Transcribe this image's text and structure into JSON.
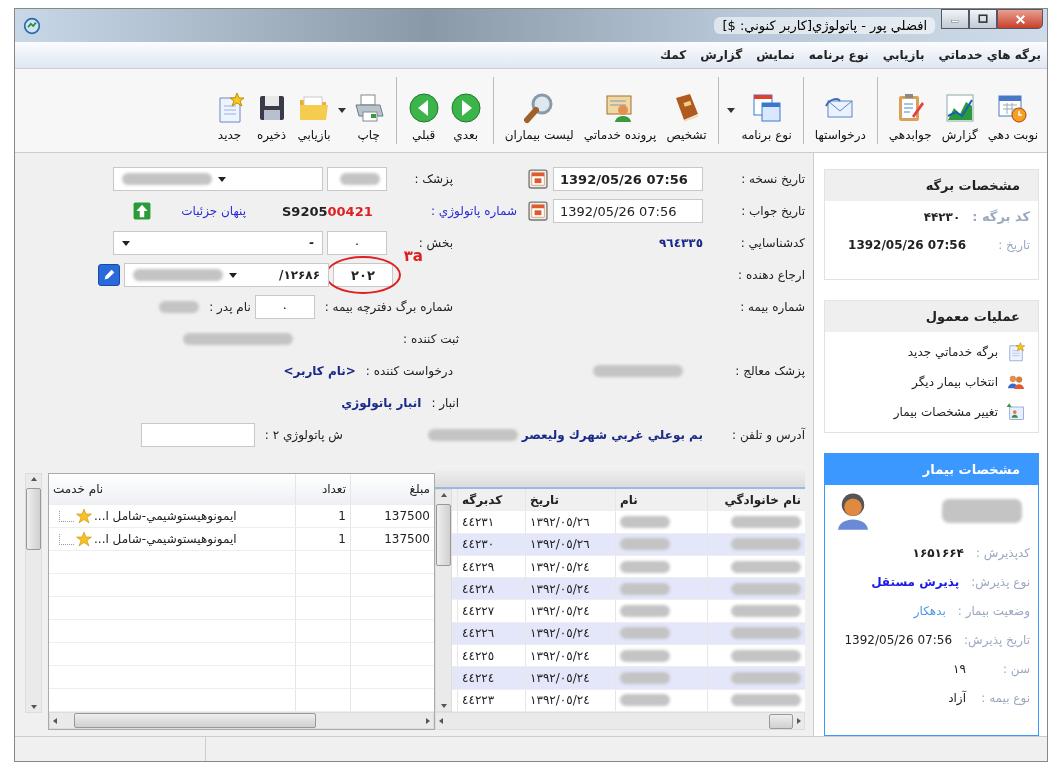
{
  "window": {
    "title": "افضلي پور - پاتولوژي[كاربر كنوني: $]"
  },
  "menu": [
    "برگه هاي خدماتي",
    "بازيابي",
    "نوع برنامه",
    "نمايش",
    "گزارش",
    "كمك"
  ],
  "toolbar": [
    [
      {
        "label": "نوبت دهي",
        "kind": "calendar"
      },
      {
        "label": "گزارش",
        "kind": "chart"
      },
      {
        "label": "جوابدهي",
        "kind": "clipboard"
      }
    ],
    [
      {
        "label": "درخواستها",
        "kind": "mail"
      }
    ],
    [
      {
        "label": "نوع برنامه",
        "kind": "windows",
        "dropdown": true
      }
    ],
    [
      {
        "label": "تشخيص",
        "kind": "book"
      },
      {
        "label": "پرونده خدماتي",
        "kind": "file"
      },
      {
        "label": "ليست بيماران",
        "kind": "search"
      }
    ],
    [
      {
        "label": "بعدي",
        "kind": "next"
      },
      {
        "label": "قبلي",
        "kind": "prev"
      }
    ],
    [
      {
        "label": "چاپ",
        "kind": "printer",
        "dropdown": true
      },
      {
        "label": "بازيابي",
        "kind": "folder"
      },
      {
        "label": "ذخيره",
        "kind": "save"
      },
      {
        "label": "جديد",
        "kind": "new"
      }
    ]
  ],
  "form": {
    "prescription_date": {
      "label": "تاريخ نسخه :",
      "value": "1392/05/26 07:56"
    },
    "physician": {
      "label": "پزشک :"
    },
    "answer_date": {
      "label": "تاريخ جواب :",
      "value": "1392/05/26 07:56"
    },
    "pathology_no": {
      "label": "شماره پاتولوژي :",
      "prefix": "S9205",
      "number": "00421"
    },
    "hide_details": {
      "label": "پنهان جزئيات"
    },
    "id_code": {
      "label": "كدشناسايي :",
      "value": "٩٦٤٣٣٥"
    },
    "ward": {
      "label": "بخش :",
      "code": "۰",
      "name": "-"
    },
    "referrer": {
      "label": "ارجاع دهنده :",
      "code": "۲۰۲",
      "name": "۱۲۶۸۶/"
    },
    "annotation": {
      "label": "۳a"
    },
    "insurance_no": {
      "label": "شماره بيمه :"
    },
    "booklet_page": {
      "label": "شماره برگ دفترچه بيمه :",
      "value": "۰"
    },
    "father_name": {
      "label": "نام پدر :"
    },
    "registrar": {
      "label": "ثبت كننده :"
    },
    "treating_physician": {
      "label": "پزشک معالج :"
    },
    "requester": {
      "label": "درخواست كننده :",
      "value": "<نام كاربر>"
    },
    "store": {
      "label": "انبار :",
      "value": "انبار پاتولوژي"
    },
    "address": {
      "label": "آدرس و تلفن :",
      "value": "بم بوعلي غربي شهرك وليعصر"
    },
    "pathology_no_2": {
      "label": "ش پاتولوژي ۲ :"
    }
  },
  "services": {
    "columns": [
      "مبلغ",
      "تعداد",
      "نام خدمت"
    ],
    "rows": [
      {
        "amount": "137500",
        "count": "1",
        "name": "ايمونوهيستوشيمي-شامل ا..."
      },
      {
        "amount": "137500",
        "count": "1",
        "name": "ايمونوهيستوشيمي-شامل ا..."
      }
    ]
  },
  "sheets": {
    "columns": [
      "نام خانوادگي",
      "نام",
      "تاريخ",
      "كدبرگه"
    ],
    "rows": [
      {
        "date": "١٣٩٢/٠٥/٢٦",
        "code": "٤٤٢٣١"
      },
      {
        "date": "١٣٩٢/٠٥/٢٦",
        "code": "٤٤٢٣٠"
      },
      {
        "date": "١٣٩٢/٠٥/٢٤",
        "code": "٤٤٢٢٩"
      },
      {
        "date": "١٣٩٢/٠٥/٢٤",
        "code": "٤٤٢٢٨"
      },
      {
        "date": "١٣٩٢/٠٥/٢٤",
        "code": "٤٤٢٢٧"
      },
      {
        "date": "١٣٩٢/٠٥/٢٤",
        "code": "٤٤٢٢٦"
      },
      {
        "date": "١٣٩٢/٠٥/٢٤",
        "code": "٤٤٢٢٥"
      },
      {
        "date": "١٣٩٢/٠٥/٢٤",
        "code": "٤٤٢٢٤"
      },
      {
        "date": "١٣٩٢/٠٥/٢٤",
        "code": "٤٤٢٢٣"
      }
    ]
  },
  "sheet_info": {
    "title": "مشخصات برگه",
    "fields": [
      {
        "label": "كد برگه :",
        "value": "۴۴۲۳۰"
      },
      {
        "label": "تاريخ :",
        "value": "1392/05/26 07:56"
      }
    ]
  },
  "common_actions": {
    "title": "عمليات معمول",
    "items": [
      {
        "label": "برگه خدماتي جديد",
        "kind": "new"
      },
      {
        "label": "انتخاب بيمار ديگر",
        "kind": "people"
      },
      {
        "label": "تغيير مشخصات بيمار",
        "kind": "card"
      }
    ]
  },
  "patient_info": {
    "title": "مشخصات بيمار",
    "fields": [
      {
        "label": "كدپذيرش :",
        "value": "۱۶۵۱۶۶۴"
      },
      {
        "label": "نوع پذيرش:",
        "value": "پذيرش مستقل"
      },
      {
        "label": "وضعيت بيمار :",
        "value": "بدهكار"
      },
      {
        "label": "تاريخ پذيرش:",
        "value": "1392/05/26 07:56"
      },
      {
        "label": "سن :",
        "value": "۱۹"
      },
      {
        "label": "نوع بيمه :",
        "value": "آزاد"
      }
    ]
  }
}
